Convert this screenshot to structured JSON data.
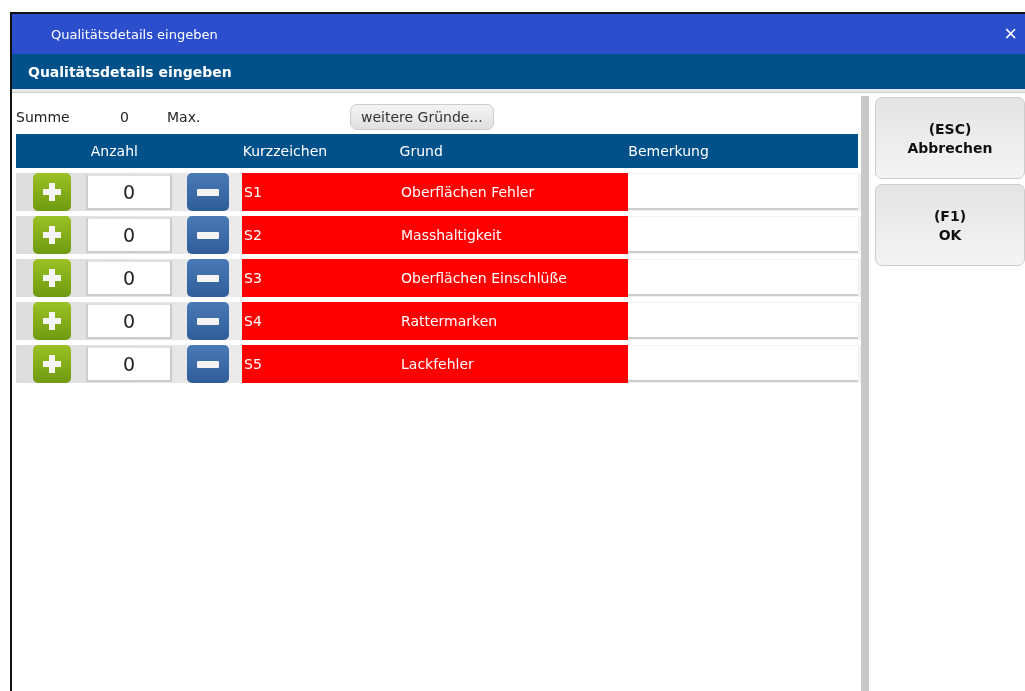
{
  "window": {
    "title": "Qualitätsdetails eingeben",
    "close": "×"
  },
  "header": {
    "title": "Qualitätsdetails eingeben"
  },
  "summary": {
    "sum_label": "Summe",
    "sum_value": "0",
    "max_label": "Max.",
    "more_button": "weitere Gründe..."
  },
  "table": {
    "columns": [
      "Anzahl",
      "Kurzzeichen",
      "Grund",
      "Bemerkung"
    ],
    "rows": [
      {
        "count": "0",
        "code": "S1",
        "reason": "Oberflächen Fehler",
        "color": "#ff0000"
      },
      {
        "count": "0",
        "code": "S2",
        "reason": "Masshaltigkeit",
        "color": "#ff0000"
      },
      {
        "count": "0",
        "code": "S3",
        "reason": "Oberflächen Einschlüße",
        "color": "#ff0000"
      },
      {
        "count": "0",
        "code": "S4",
        "reason": "Rattermarken",
        "color": "#ff0000"
      },
      {
        "count": "0",
        "code": "S5",
        "reason": "Lackfehler",
        "color": "#ff0000"
      }
    ]
  },
  "buttons": [
    {
      "key": "(ESC)",
      "label": "Abbrechen"
    },
    {
      "key": "(F1)",
      "label": "OK"
    }
  ]
}
